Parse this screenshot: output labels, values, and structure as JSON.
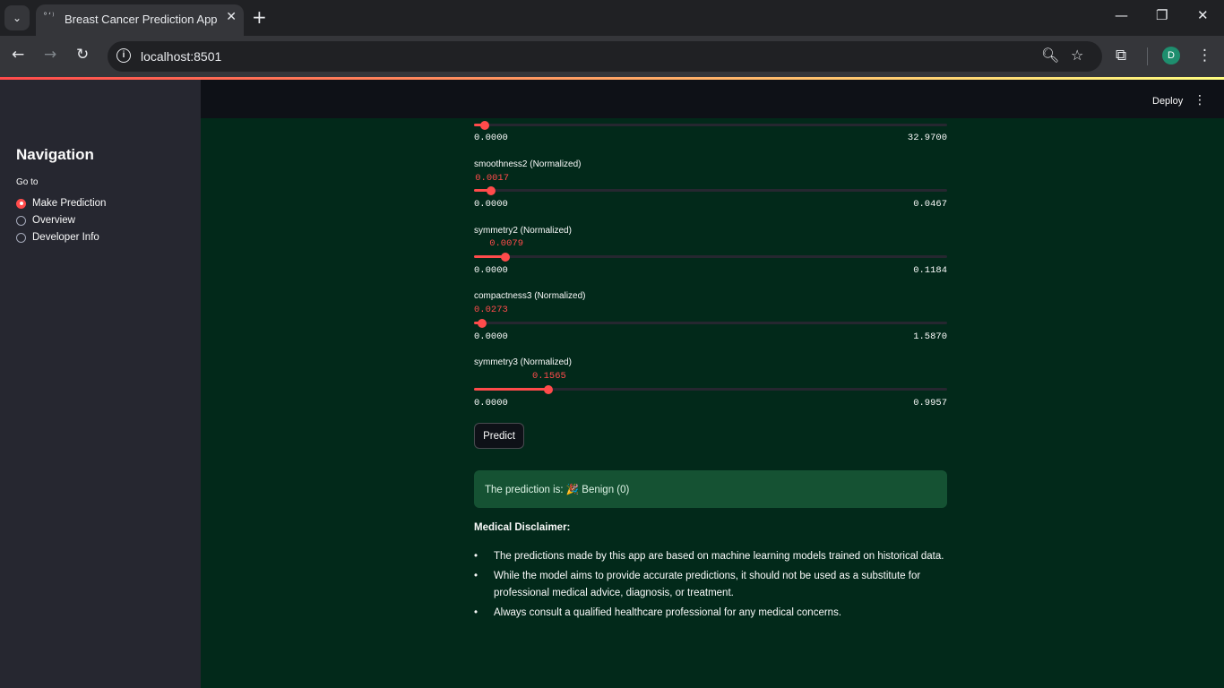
{
  "browser": {
    "tab_title": "Breast Cancer Prediction App",
    "tab_favicon": "°ʻ⁾",
    "url": "localhost:8501",
    "profile_initial": "D"
  },
  "icons": {
    "tab_menu": "chevron-down-icon",
    "tab_close": "close-icon",
    "new_tab": "plus-icon",
    "back": "back-arrow-icon",
    "forward": "forward-arrow-icon",
    "reload": "reload-icon",
    "zoom": "zoom-icon",
    "bookmark": "star-icon",
    "extensions": "puzzle-icon"
  },
  "sidebar": {
    "title": "Navigation",
    "radio_label": "Go to",
    "options": [
      {
        "label": "Make Prediction",
        "selected": true
      },
      {
        "label": "Overview",
        "selected": false
      },
      {
        "label": "Developer Info",
        "selected": false
      }
    ]
  },
  "header": {
    "deploy_label": "Deploy"
  },
  "sliders": [
    {
      "label": "",
      "value": "",
      "min": "0.0000",
      "max": "32.9700",
      "fraction": 0.023
    },
    {
      "label": "smoothness2 (Normalized)",
      "value": "0.0017",
      "min": "0.0000",
      "max": "0.0467",
      "fraction": 0.0364
    },
    {
      "label": "symmetry2 (Normalized)",
      "value": "0.0079",
      "min": "0.0000",
      "max": "0.1184",
      "fraction": 0.0667
    },
    {
      "label": "compactness3 (Normalized)",
      "value": "0.0273",
      "min": "0.0000",
      "max": "1.5870",
      "fraction": 0.0172
    },
    {
      "label": "symmetry3 (Normalized)",
      "value": "0.1565",
      "min": "0.0000",
      "max": "0.9957",
      "fraction": 0.1572
    }
  ],
  "predict_button": "Predict",
  "result": {
    "text": "The prediction is: 🎉 Benign (0)"
  },
  "disclaimer": {
    "title": "Medical Disclaimer:",
    "items": [
      "The predictions made by this app are based on machine learning models trained on historical data.",
      "While the model aims to provide accurate predictions, it should not be used as a substitute for professional medical advice, diagnosis, or treatment.",
      "Always consult a qualified healthcare professional for any medical concerns."
    ]
  },
  "colors": {
    "accent": "#ff4b4b",
    "background": "#02291a",
    "sidebar": "#262730",
    "success": "#155233"
  }
}
